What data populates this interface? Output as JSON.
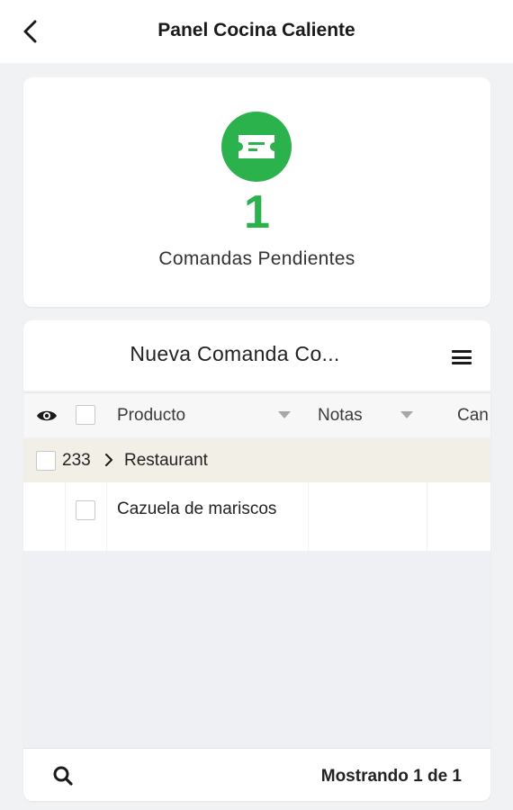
{
  "theme": {
    "accent": "#2bb24c"
  },
  "header": {
    "title": "Panel Cocina Caliente",
    "back_icon": "chevron-left-icon"
  },
  "summary": {
    "icon": "ticket-icon",
    "count": "1",
    "label": "Comandas Pendientes"
  },
  "grid": {
    "title": "Nueva Comanda Co...",
    "menu_icon": "hamburger-menu-icon",
    "columns": [
      "Producto",
      "Notas",
      "Can"
    ],
    "group": {
      "number": "233",
      "name": "Restaurant"
    },
    "items": [
      {
        "product": "Cazuela de mariscos"
      }
    ],
    "footer": {
      "showing": "Mostrando 1 de 1",
      "search_icon": "search-icon"
    }
  }
}
